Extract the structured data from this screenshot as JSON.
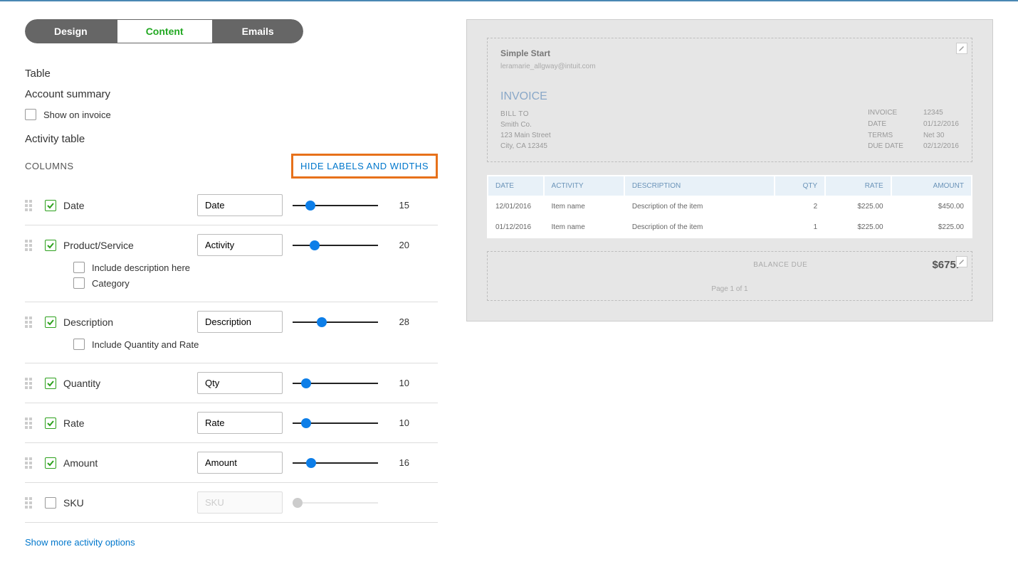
{
  "tabs": {
    "design": "Design",
    "content": "Content",
    "emails": "Emails"
  },
  "sections": {
    "table": "Table",
    "account_summary": "Account summary",
    "show_on_invoice": "Show on invoice",
    "activity_table": "Activity table",
    "columns": "COLUMNS",
    "hide_labels": "HIDE LABELS AND WIDTHS",
    "more_options": "Show more activity options"
  },
  "columns": [
    {
      "name": "Date",
      "checked": true,
      "label": "Date",
      "width": "15",
      "sub": []
    },
    {
      "name": "Product/Service",
      "checked": true,
      "label": "Activity",
      "width": "20",
      "sub": [
        {
          "name": "Include description here",
          "checked": false
        },
        {
          "name": "Category",
          "checked": false
        }
      ]
    },
    {
      "name": "Description",
      "checked": true,
      "label": "Description",
      "width": "28",
      "sub": [
        {
          "name": "Include Quantity and Rate",
          "checked": false
        }
      ]
    },
    {
      "name": "Quantity",
      "checked": true,
      "label": "Qty",
      "width": "10",
      "sub": []
    },
    {
      "name": "Rate",
      "checked": true,
      "label": "Rate",
      "width": "10",
      "sub": []
    },
    {
      "name": "Amount",
      "checked": true,
      "label": "Amount",
      "width": "16",
      "sub": []
    },
    {
      "name": "SKU",
      "checked": false,
      "label": "SKU",
      "width": "",
      "sub": []
    }
  ],
  "preview": {
    "company": "Simple Start",
    "email": "leramarie_allgway@intuit.com",
    "invoice": "INVOICE",
    "bill_to_label": "BILL TO",
    "bill_to": {
      "name": "Smith Co.",
      "addr1": "123 Main Street",
      "addr2": "City, CA 12345"
    },
    "meta": {
      "invoice_lbl": "INVOICE",
      "invoice_no": "12345",
      "date_lbl": "DATE",
      "date": "01/12/2016",
      "terms_lbl": "TERMS",
      "terms": "Net 30",
      "due_lbl": "DUE DATE",
      "due": "02/12/2016"
    },
    "table": {
      "headers": {
        "date": "DATE",
        "activity": "ACTIVITY",
        "description": "DESCRIPTION",
        "qty": "QTY",
        "rate": "RATE",
        "amount": "AMOUNT"
      },
      "rows": [
        {
          "date": "12/01/2016",
          "activity": "Item name",
          "description": "Description of the item",
          "qty": "2",
          "rate": "$225.00",
          "amount": "$450.00"
        },
        {
          "date": "01/12/2016",
          "activity": "Item name",
          "description": "Description of the item",
          "qty": "1",
          "rate": "$225.00",
          "amount": "$225.00"
        }
      ]
    },
    "balance_label": "BALANCE DUE",
    "balance": "$675.",
    "page": "Page 1 of 1"
  }
}
